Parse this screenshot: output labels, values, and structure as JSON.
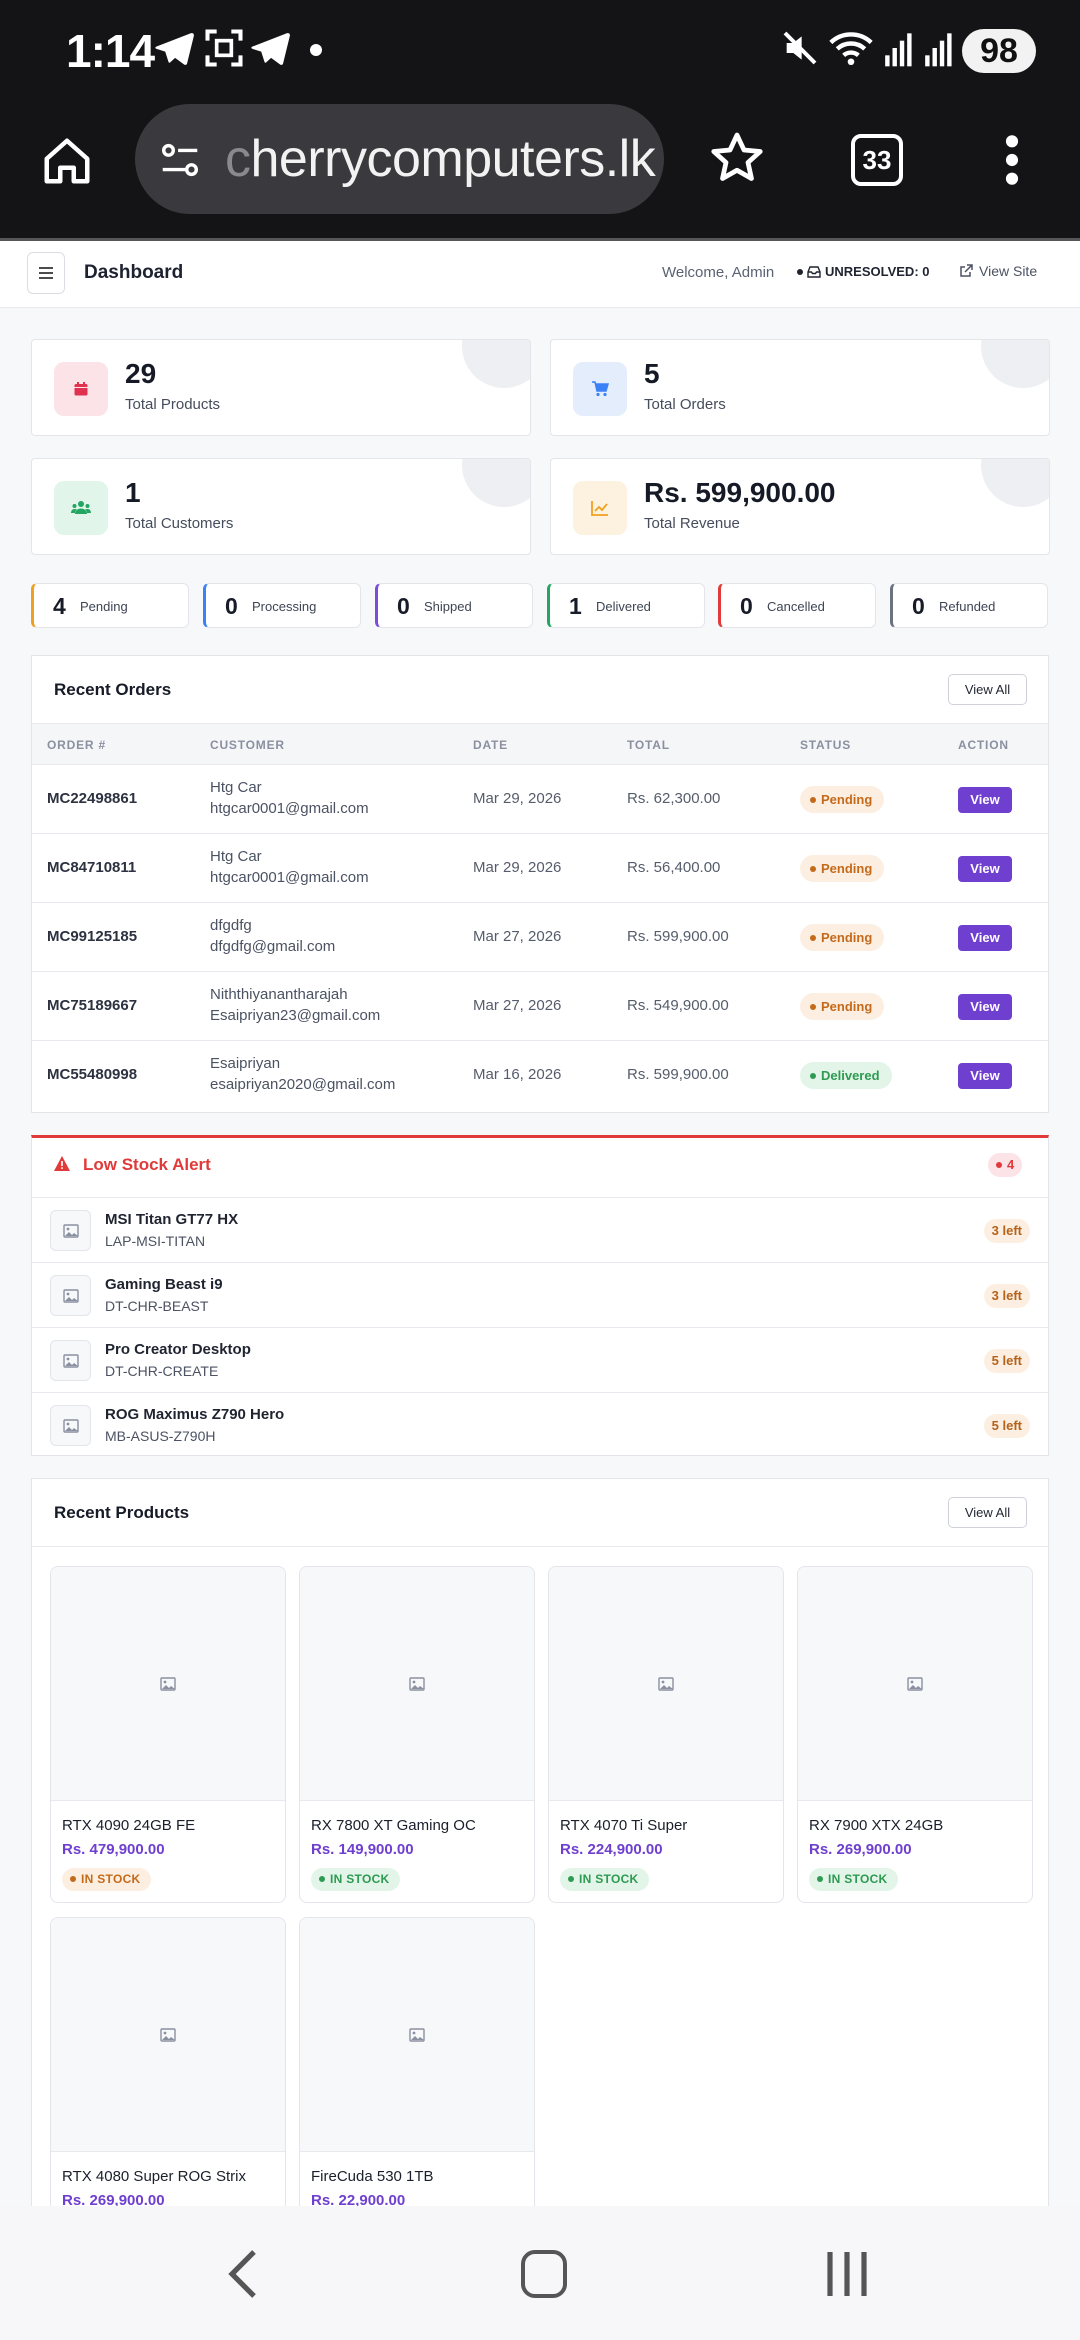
{
  "status_bar": {
    "time": "1:14",
    "battery": "98"
  },
  "browser": {
    "url": "herrycomputers.lk",
    "url_prefix_faded": "c",
    "tab_count": "33"
  },
  "header": {
    "title": "Dashboard",
    "welcome": "Welcome, Admin",
    "unresolved": "UNRESOLVED: 0",
    "view_site": "View Site"
  },
  "stats": [
    {
      "value": "29",
      "label": "Total Products",
      "icon": "calendar-icon",
      "accent": "#e0324f",
      "bg": "#fbe3e7"
    },
    {
      "value": "5",
      "label": "Total Orders",
      "icon": "cart-icon",
      "accent": "#3b82f6",
      "bg": "#e4edfb"
    },
    {
      "value": "1",
      "label": "Total Customers",
      "icon": "users-icon",
      "accent": "#22a661",
      "bg": "#e1f5ea"
    },
    {
      "value": "Rs. 599,900.00",
      "label": "Total Revenue",
      "icon": "chart-line-icon",
      "accent": "#f0a020",
      "bg": "#fdf1df"
    }
  ],
  "order_status": [
    {
      "count": "4",
      "label": "Pending",
      "color": "#f0a020"
    },
    {
      "count": "0",
      "label": "Processing",
      "color": "#3b82f6"
    },
    {
      "count": "0",
      "label": "Shipped",
      "color": "#7c4ddb"
    },
    {
      "count": "1",
      "label": "Delivered",
      "color": "#22a661"
    },
    {
      "count": "0",
      "label": "Cancelled",
      "color": "#e03a3a"
    },
    {
      "count": "0",
      "label": "Refunded",
      "color": "#6b7280"
    }
  ],
  "recent_orders": {
    "title": "Recent Orders",
    "view_all": "View All",
    "columns": [
      "ORDER #",
      "CUSTOMER",
      "DATE",
      "TOTAL",
      "STATUS",
      "ACTION"
    ],
    "rows": [
      {
        "order": "MC22498861",
        "name": "Htg Car",
        "email": "htgcar0001@gmail.com",
        "date": "Mar 29, 2026",
        "total": "Rs. 62,300.00",
        "status": "Pending",
        "action": "View"
      },
      {
        "order": "MC84710811",
        "name": "Htg Car",
        "email": "htgcar0001@gmail.com",
        "date": "Mar 29, 2026",
        "total": "Rs. 56,400.00",
        "status": "Pending",
        "action": "View"
      },
      {
        "order": "MC99125185",
        "name": "dfgdfg",
        "email": "dfgdfg@gmail.com",
        "date": "Mar 27, 2026",
        "total": "Rs. 599,900.00",
        "status": "Pending",
        "action": "View"
      },
      {
        "order": "MC75189667",
        "name": "Niththiyanantharajah",
        "email": "Esaipriyan23@gmail.com",
        "date": "Mar 27, 2026",
        "total": "Rs. 549,900.00",
        "status": "Pending",
        "action": "View"
      },
      {
        "order": "MC55480998",
        "name": "Esaipriyan",
        "email": "esaipriyan2020@gmail.com",
        "date": "Mar 16, 2026",
        "total": "Rs. 599,900.00",
        "status": "Delivered",
        "action": "View"
      }
    ]
  },
  "low_stock": {
    "title": "Low Stock Alert",
    "count": "4",
    "items": [
      {
        "name": "MSI Titan GT77 HX",
        "sku": "LAP-MSI-TITAN",
        "left": "3 left"
      },
      {
        "name": "Gaming Beast i9",
        "sku": "DT-CHR-BEAST",
        "left": "3 left"
      },
      {
        "name": "Pro Creator Desktop",
        "sku": "DT-CHR-CREATE",
        "left": "5 left"
      },
      {
        "name": "ROG Maximus Z790 Hero",
        "sku": "MB-ASUS-Z790H",
        "left": "5 left"
      }
    ]
  },
  "recent_products": {
    "title": "Recent Products",
    "view_all": "View All",
    "items": [
      {
        "name": "RTX 4090 24GB FE",
        "price": "Rs. 479,900.00",
        "stock": "IN STOCK",
        "stock_color": "orange"
      },
      {
        "name": "RX 7800 XT Gaming OC",
        "price": "Rs. 149,900.00",
        "stock": "IN STOCK",
        "stock_color": "green"
      },
      {
        "name": "RTX 4070 Ti Super",
        "price": "Rs. 224,900.00",
        "stock": "IN STOCK",
        "stock_color": "green"
      },
      {
        "name": "RX 7900 XTX 24GB",
        "price": "Rs. 269,900.00",
        "stock": "IN STOCK",
        "stock_color": "green"
      },
      {
        "name": "RTX 4080 Super ROG Strix",
        "price": "Rs. 269,900.00",
        "stock": "",
        "stock_color": "green"
      },
      {
        "name": "FireCuda 530 1TB",
        "price": "Rs. 22,900.00",
        "stock": "",
        "stock_color": "green"
      }
    ]
  }
}
